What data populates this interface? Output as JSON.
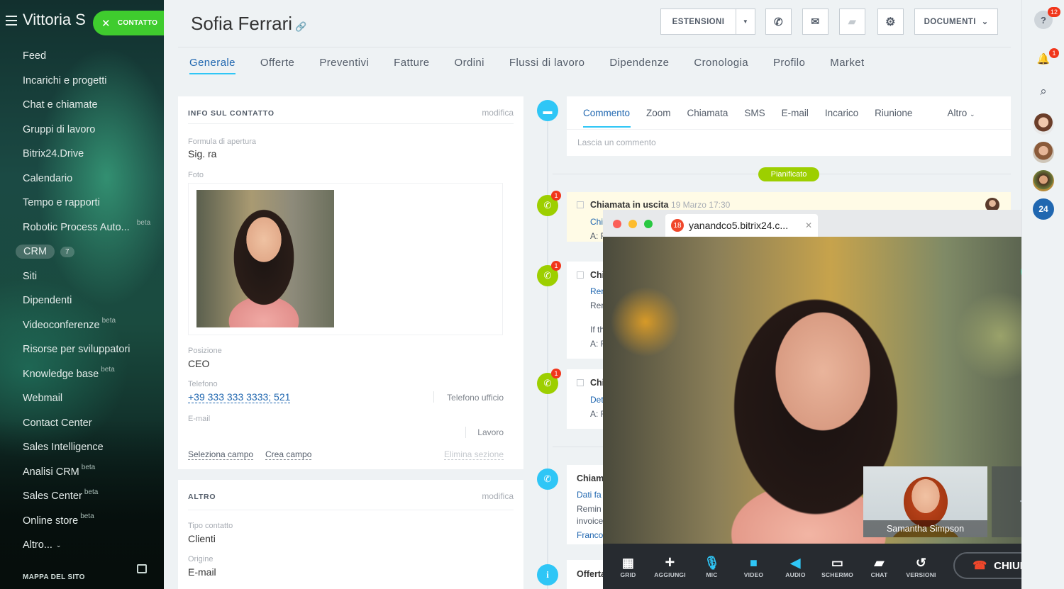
{
  "sidebar": {
    "title": "Vittoria S",
    "contact_button": "CONTATTO",
    "items": [
      {
        "label": "Feed",
        "beta": ""
      },
      {
        "label": "Incarichi e progetti",
        "beta": ""
      },
      {
        "label": "Chat e chiamate",
        "beta": ""
      },
      {
        "label": "Gruppi di lavoro",
        "beta": ""
      },
      {
        "label": "Bitrix24.Drive",
        "beta": ""
      },
      {
        "label": "Calendario",
        "beta": ""
      },
      {
        "label": "Tempo e rapporti",
        "beta": ""
      },
      {
        "label": "Robotic Process Auto...",
        "beta": "beta"
      },
      {
        "label": "CRM",
        "beta": "",
        "count": "7"
      },
      {
        "label": "Siti",
        "beta": ""
      },
      {
        "label": "Dipendenti",
        "beta": ""
      },
      {
        "label": "Videoconferenze",
        "beta": "beta"
      },
      {
        "label": "Risorse per sviluppatori",
        "beta": ""
      },
      {
        "label": "Knowledge base",
        "beta": "beta"
      },
      {
        "label": "Webmail",
        "beta": ""
      },
      {
        "label": "Contact Center",
        "beta": ""
      },
      {
        "label": "Sales Intelligence",
        "beta": ""
      },
      {
        "label": "Analisi CRM",
        "beta": "beta"
      },
      {
        "label": "Sales Center",
        "beta": "beta"
      },
      {
        "label": "Online store",
        "beta": "beta"
      },
      {
        "label": "Altro...",
        "beta": ""
      }
    ],
    "footer": "MAPPA DEL SITO"
  },
  "header": {
    "title": "Sofia  Ferrari",
    "estensioni": "ESTENSIONI",
    "documenti": "DOCUMENTI"
  },
  "tabs": [
    "Generale",
    "Offerte",
    "Preventivi",
    "Fatture",
    "Ordini",
    "Flussi di lavoro",
    "Dipendenze",
    "Cronologia",
    "Profilo",
    "Market"
  ],
  "contact_info": {
    "heading": "INFO SUL CONTATTO",
    "edit": "modifica",
    "salutation_label": "Formula di apertura",
    "salutation": "Sig. ra",
    "photo_label": "Foto",
    "position_label": "Posizione",
    "position": "CEO",
    "phone_label": "Telefono",
    "phone": "+39 333 333 3333; 521",
    "phone_type": "Telefono ufficio",
    "email_label": "E-mail",
    "email_type": "Lavoro",
    "select_field": "Seleziona campo",
    "create_field": "Crea campo",
    "delete_section": "Elimina sezione"
  },
  "other": {
    "heading": "ALTRO",
    "edit": "modifica",
    "type_label": "Tipo contatto",
    "type": "Clienti",
    "source_label": "Origine",
    "source": "E-mail"
  },
  "activity_tabs": [
    "Commento",
    "Zoom",
    "Chiamata",
    "SMS",
    "E-mail",
    "Incarico",
    "Riunione"
  ],
  "activity_more": "Altro",
  "comment_placeholder": "Lascia un commento",
  "planned": "Pianificato",
  "timeline": {
    "item1_title": "Chiamata in uscita",
    "item1_date": "19 Marzo 17:30",
    "item1_l1": "Chi",
    "item1_l2": "A: F",
    "item2_title": "Chi",
    "item2_l1": "Rer",
    "item2_l2": "Rer",
    "item2_l3": "If th",
    "item2_l4": "A: F",
    "item3_title": "Chi",
    "item3_l1": "Det",
    "item3_l2": "A: F",
    "item4_title": "Chiam",
    "item4_l1": "Dati fa",
    "item4_l2": "Remin",
    "item4_l3": "invoice",
    "item4_l4": "Franco",
    "item5_title": "Offerta",
    "badge": "1"
  },
  "video": {
    "tab_count": "18",
    "tab_title": "yanandco5.bitrix24.c...",
    "pip_name": "Samantha Simpson",
    "controls": [
      "GRID",
      "AGGIUNGI",
      "MIC",
      "VIDEO",
      "AUDIO",
      "SCHERMO",
      "CHAT",
      "VERSIONI"
    ],
    "close": "CHIUDI"
  },
  "rail": {
    "help_badge": "12",
    "bell_badge": "1",
    "counter": "24"
  }
}
